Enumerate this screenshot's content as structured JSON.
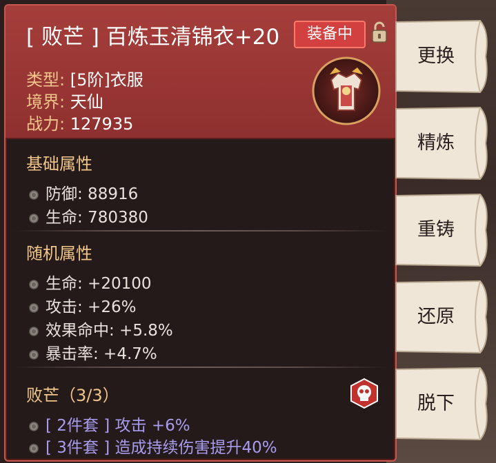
{
  "item": {
    "title": "[ 败芒 ] 百炼玉清锦衣+20",
    "equipped_label": "装备中",
    "type_label": "类型:",
    "type_value": "[5阶]衣服",
    "realm_label": "境界:",
    "realm_value": "天仙",
    "power_label": "战力:",
    "power_value": "127935"
  },
  "base_attributes": {
    "title": "基础属性",
    "stats": [
      "防御: 88916",
      "生命: 780380"
    ]
  },
  "random_attributes": {
    "title": "随机属性",
    "stats": [
      "生命: +20100",
      "攻击: +26%",
      "效果命中: +5.8%",
      "暴击率: +4.7%"
    ]
  },
  "set_bonus": {
    "title": "败芒（3/3）",
    "bonuses": [
      "[ 2件套 ] 攻击 +6%",
      "[ 3件套 ] 造成持续伤害提升40%"
    ]
  },
  "actions": {
    "replace": "更换",
    "refine": "精炼",
    "recast": "重铸",
    "restore": "还原",
    "unequip": "脱下"
  },
  "colors": {
    "header_red": "#a53e3b",
    "label_gold": "#f2c58a",
    "set_purple": "#a99cf0",
    "badge_red": "#d24040"
  },
  "icons": [
    "lock-icon",
    "armor-item-icon",
    "skull-badge-icon",
    "bullet-dot-icon"
  ]
}
